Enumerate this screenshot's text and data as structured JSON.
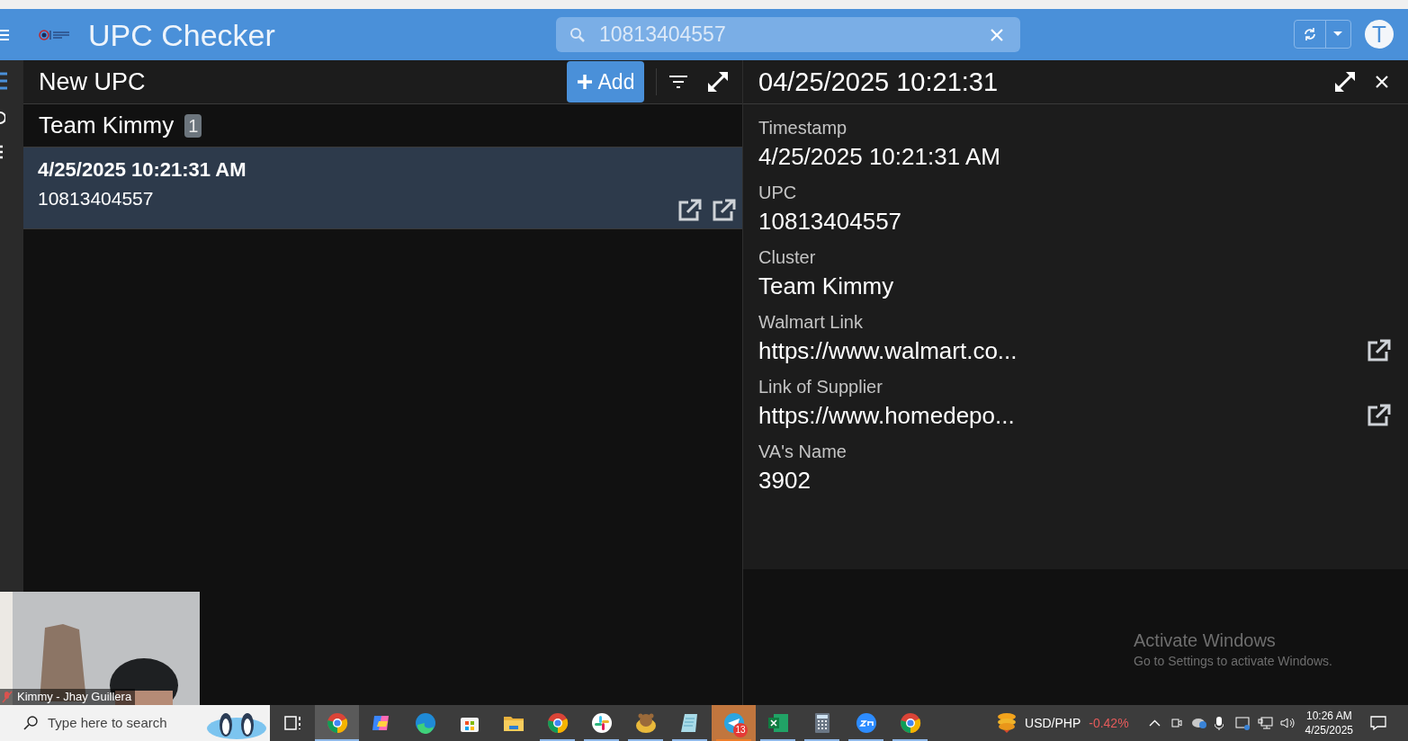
{
  "header": {
    "title": "UPC Checker",
    "search": {
      "value": "10813404557"
    },
    "avatar": "T"
  },
  "list_panel": {
    "title": "New UPC",
    "add_button": "Add",
    "group": {
      "name": "Team Kimmy",
      "count": "1"
    },
    "items": [
      {
        "timestamp": "4/25/2025 10:21:31 AM",
        "upc": "10813404557",
        "selected": true
      }
    ]
  },
  "detail": {
    "title": "04/25/2025 10:21:31",
    "fields": [
      {
        "label": "Timestamp",
        "value": "4/25/2025 10:21:31 AM",
        "kind": "text"
      },
      {
        "label": "UPC",
        "value": "10813404557",
        "kind": "text"
      },
      {
        "label": "Cluster",
        "value": "Team Kimmy",
        "kind": "text"
      },
      {
        "label": "Walmart Link",
        "value": "https://www.walmart.co...",
        "kind": "link"
      },
      {
        "label": "Link of Supplier",
        "value": "https://www.homedepo...",
        "kind": "link"
      },
      {
        "label": "VA's Name",
        "value": "3902",
        "kind": "text"
      }
    ]
  },
  "video_tile": {
    "kind": "picture",
    "name": "Kimmy - Jhay Guillera",
    "muted": true
  },
  "activation_notice": {
    "title": "Activate Windows",
    "subtitle": "Go to Settings to activate Windows."
  },
  "taskbar": {
    "search": {
      "placeholder": "Type here to search"
    },
    "apps": [
      {
        "kind": "taskview",
        "selected": false,
        "running": false,
        "flashing": false
      },
      {
        "kind": "chrome",
        "selected": true,
        "running": true,
        "flashing": false
      },
      {
        "kind": "copilot",
        "selected": false,
        "running": false,
        "flashing": false
      },
      {
        "kind": "edge",
        "selected": false,
        "running": false,
        "flashing": false
      },
      {
        "kind": "store",
        "selected": false,
        "running": false,
        "flashing": false
      },
      {
        "kind": "folder",
        "selected": false,
        "running": false,
        "flashing": false
      },
      {
        "kind": "chrome",
        "selected": false,
        "running": true,
        "flashing": false
      },
      {
        "kind": "slack",
        "selected": false,
        "running": true,
        "flashing": false
      },
      {
        "kind": "bear",
        "selected": false,
        "running": true,
        "flashing": false
      },
      {
        "kind": "notepad",
        "selected": false,
        "running": true,
        "flashing": false
      },
      {
        "kind": "telegram",
        "selected": false,
        "running": true,
        "flashing": true,
        "badge": "13"
      },
      {
        "kind": "excel",
        "selected": false,
        "running": true,
        "flashing": false
      },
      {
        "kind": "calculator",
        "selected": false,
        "running": true,
        "flashing": false
      },
      {
        "kind": "zoom",
        "selected": false,
        "running": true,
        "flashing": false
      },
      {
        "kind": "chrome",
        "selected": false,
        "running": true,
        "flashing": false
      }
    ],
    "ticker": {
      "pair": "USD/PHP",
      "change": "-0.42%"
    },
    "clock": {
      "time": "10:26 AM",
      "date": "4/25/2025"
    }
  }
}
